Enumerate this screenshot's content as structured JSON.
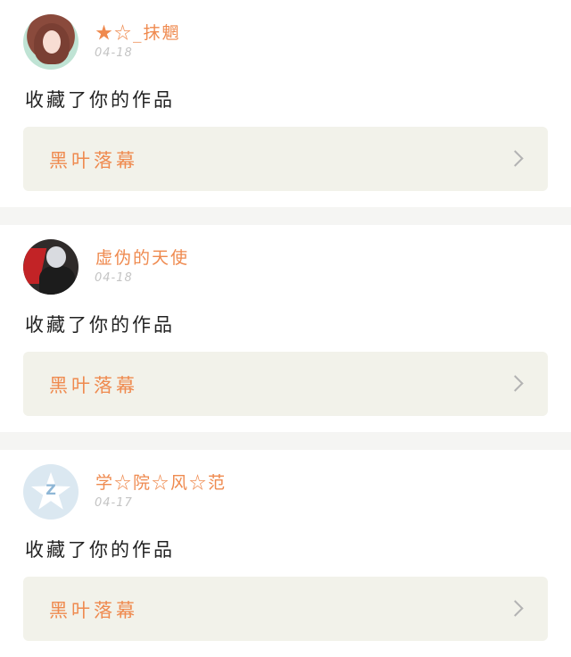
{
  "notifications": [
    {
      "username": "★☆_抹魍",
      "date": "04-18",
      "message": "收藏了你的作品",
      "work_title": "黑叶落幕"
    },
    {
      "username": "虚伪的天使",
      "date": "04-18",
      "message": "收藏了你的作品",
      "work_title": "黑叶落幕"
    },
    {
      "username": "学☆院☆风☆范",
      "date": "04-17",
      "message": "收藏了你的作品",
      "work_title": "黑叶落幕"
    }
  ],
  "colors": {
    "accent": "#ef8a4f",
    "link_card_bg": "#f2f2ea",
    "date_text": "#c4c4c4",
    "divider": "#f5f5f3"
  },
  "icons": {
    "chevron": "chevron-right-icon"
  }
}
